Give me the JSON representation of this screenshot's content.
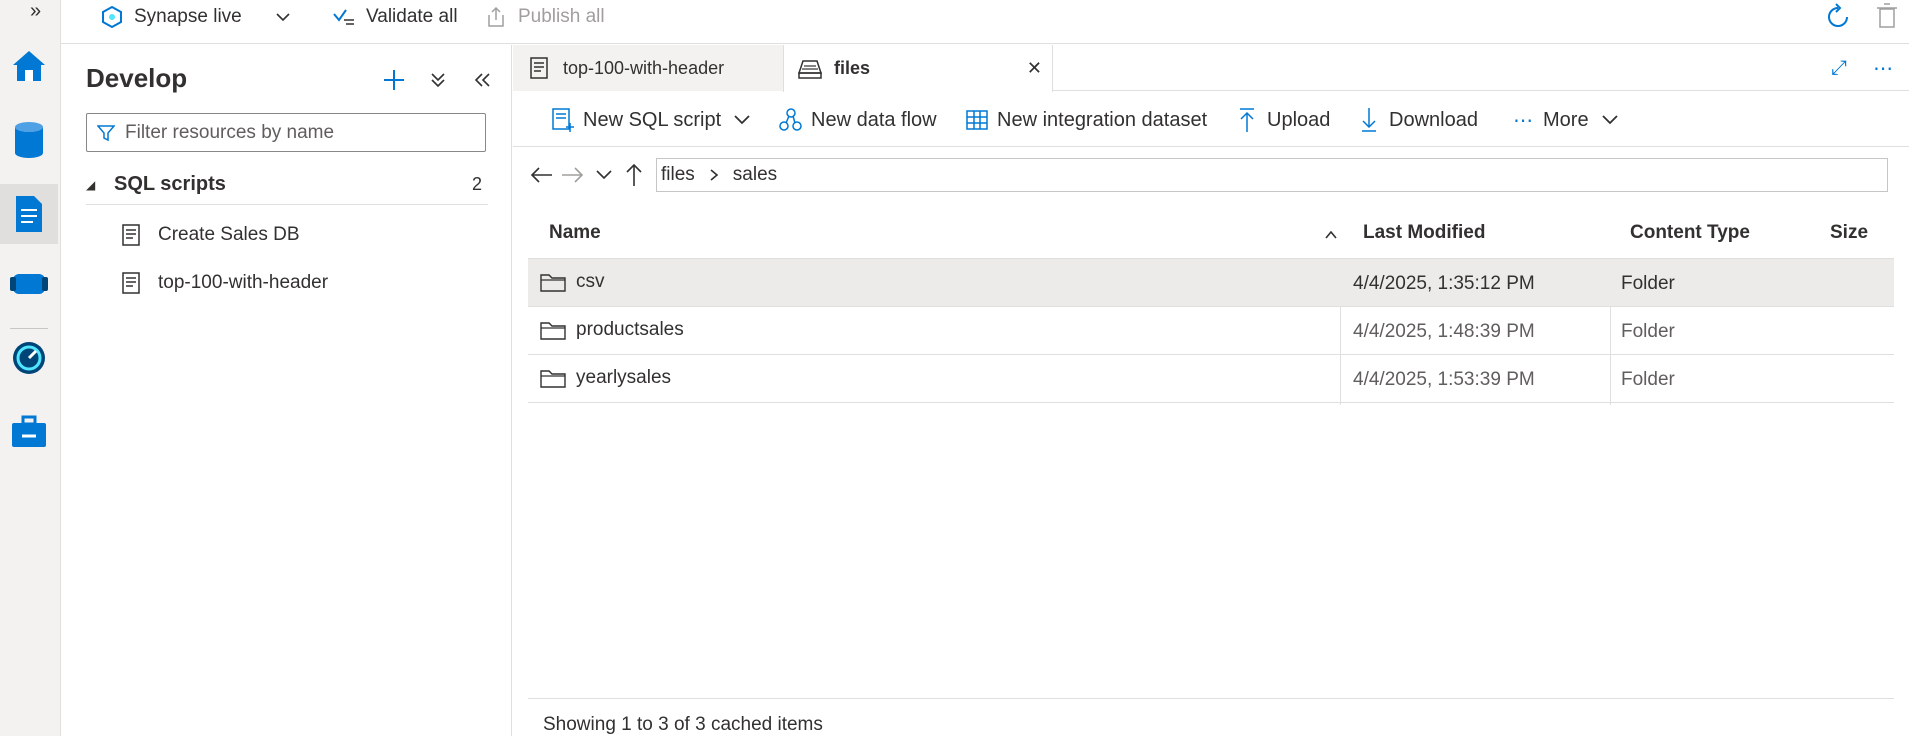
{
  "topbar": {
    "workspace_label": "Synapse live",
    "validate_label": "Validate all",
    "publish_label": "Publish all"
  },
  "rail": {
    "items": [
      "home",
      "data",
      "develop",
      "integrate",
      "monitor",
      "manage"
    ]
  },
  "develop": {
    "title": "Develop",
    "filter_placeholder": "Filter resources by name",
    "group": {
      "label": "SQL scripts",
      "count": "2"
    },
    "items": [
      "Create Sales DB",
      "top-100-with-header"
    ]
  },
  "tabs": [
    {
      "label": "top-100-with-header",
      "active": false
    },
    {
      "label": "files",
      "active": true
    }
  ],
  "toolbar": {
    "new_sql_script": "New SQL script",
    "new_data_flow": "New data flow",
    "new_integration_dataset": "New integration dataset",
    "upload": "Upload",
    "download": "Download",
    "more": "More"
  },
  "address": {
    "path": [
      "files",
      "sales"
    ]
  },
  "table": {
    "columns": [
      "Name",
      "Last Modified",
      "Content Type",
      "Size"
    ],
    "rows": [
      {
        "name": "csv",
        "modified": "4/4/2025, 1:35:12 PM",
        "type": "Folder",
        "size": "",
        "selected": true
      },
      {
        "name": "productsales",
        "modified": "4/4/2025, 1:48:39 PM",
        "type": "Folder",
        "size": "",
        "selected": false
      },
      {
        "name": "yearlysales",
        "modified": "4/4/2025, 1:53:39 PM",
        "type": "Folder",
        "size": "",
        "selected": false
      }
    ]
  },
  "footer": "Showing 1 to 3 of 3 cached items",
  "colors": {
    "accent": "#0078d4",
    "rail_bg": "#f3f2f1",
    "selected_row": "#edebe9"
  }
}
